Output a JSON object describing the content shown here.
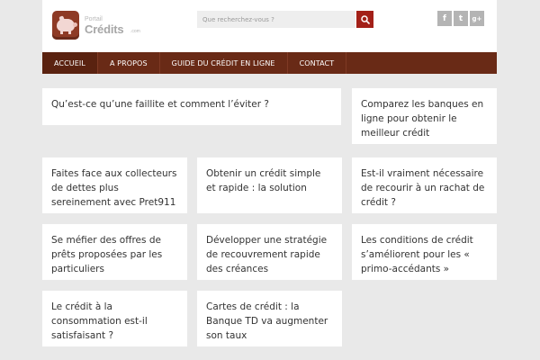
{
  "logo": {
    "small_text": "Portail",
    "main_text": "Crédits",
    "tld_text": ".com"
  },
  "search": {
    "placeholder": "Que recherchez-vous ?"
  },
  "social": [
    "f",
    "t",
    "g+"
  ],
  "nav": {
    "items": [
      "ACCUEIL",
      "A PROPOS",
      "GUIDE DU CRÉDIT EN LIGNE",
      "CONTACT"
    ]
  },
  "articles": [
    "Qu’est-ce qu’une faillite et comment l’éviter ?",
    "Comparez les banques en ligne pour obtenir le meilleur crédit",
    "Faites face aux collecteurs de dettes plus sereinement avec Pret911",
    "Obtenir un crédit simple et rapide : la solution",
    "Est-il vraiment nécessaire de recourir à un rachat de crédit ?",
    "Se méfier des offres de prêts proposées par les particuliers",
    "Développer une stratégie de recouvrement rapide des créances",
    "Les conditions de crédit s’améliorent pour les « primo-accédants »",
    "Le crédit à la consommation est-il satisfaisant ?",
    "Cartes de crédit : la Banque TD va augmenter son taux"
  ],
  "colors": {
    "nav_bg": "#692a16",
    "search_button": "#a32018",
    "background": "#e9e9e9",
    "card": "#ffffff"
  }
}
